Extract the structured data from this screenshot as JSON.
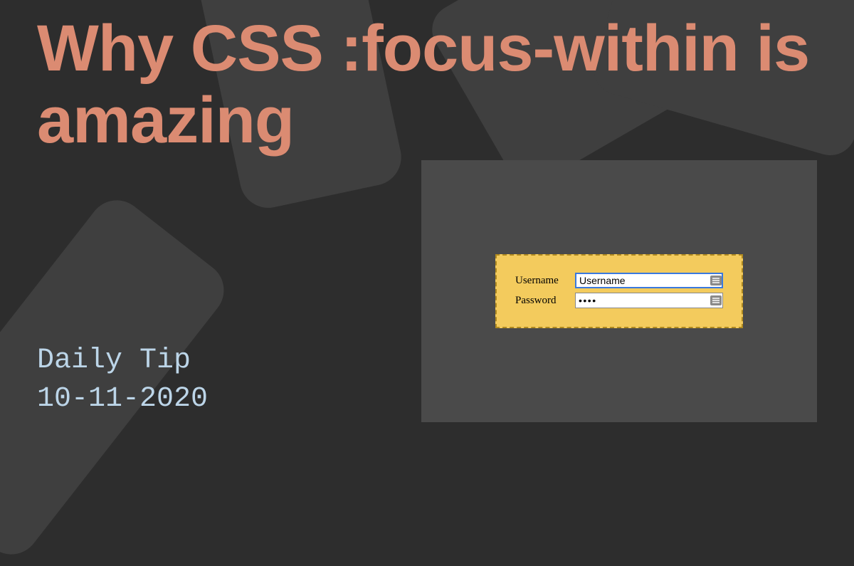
{
  "title": "Why CSS :focus-within is amazing",
  "meta": {
    "category": "Daily Tip",
    "date": "10-11-2020"
  },
  "form": {
    "username_label": "Username",
    "username_value": "Username",
    "password_label": "Password",
    "password_value": "••••"
  }
}
